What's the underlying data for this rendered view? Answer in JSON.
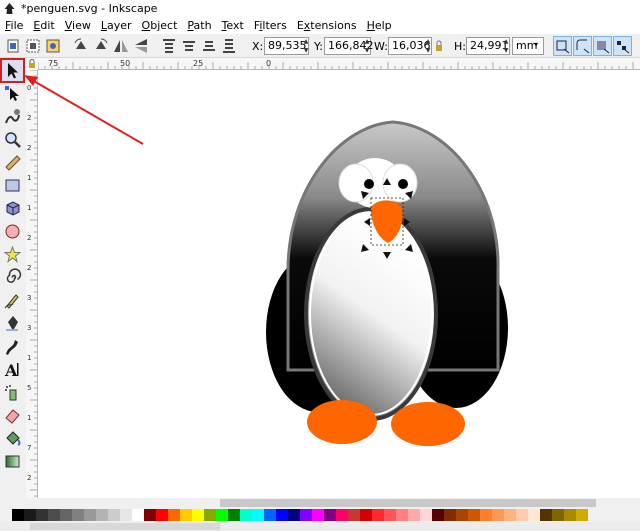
{
  "window": {
    "title": "*penguen.svg - Inkscape"
  },
  "menu": [
    "File",
    "Edit",
    "View",
    "Layer",
    "Object",
    "Path",
    "Text",
    "Filters",
    "Extensions",
    "Help"
  ],
  "menu_mnemonics": [
    "F",
    "E",
    "V",
    "L",
    "O",
    "P",
    "T",
    "i",
    "x",
    "H"
  ],
  "toolbar": {
    "x_label": "X:",
    "x_value": "89,535",
    "y_label": "Y:",
    "y_value": "166,842",
    "w_label": "W:",
    "w_value": "16,036",
    "h_label": "H:",
    "h_value": "24,991",
    "unit": "mm"
  },
  "hruler_labels": [
    "75",
    "50",
    "25",
    "0"
  ],
  "vruler_labels": [
    "0",
    "2",
    "2",
    "1",
    "1",
    "2",
    "2",
    "3",
    "3",
    "1",
    "5",
    "1",
    "7",
    "2"
  ],
  "tools": [
    "select-tool",
    "node-tool",
    "tweak-tool",
    "zoom-tool",
    "measure-tool",
    "rect-tool",
    "3dbox-tool",
    "ellipse-tool",
    "star-tool",
    "spiral-tool",
    "pencil-tool",
    "pen-tool",
    "calligraphy-tool",
    "text-tool",
    "spray-tool",
    "eraser-tool",
    "bucket-tool",
    "gradient-tool"
  ],
  "colors": {
    "accent_red": "#e02020",
    "penguin_orange": "#ff6600",
    "selection_blue": "#cde4f7"
  },
  "palette": [
    "#000000",
    "#1a1a1a",
    "#333333",
    "#4d4d4d",
    "#666666",
    "#808080",
    "#999999",
    "#b3b3b3",
    "#cccccc",
    "#e6e6e6",
    "#ffffff",
    "#800000",
    "#ff0000",
    "#ff6600",
    "#ffcc00",
    "#ffff00",
    "#88aa00",
    "#00ff00",
    "#008000",
    "#00ffcc",
    "#00ffff",
    "#0066ff",
    "#0000ff",
    "#000080",
    "#7f00ff",
    "#ff00ff",
    "#800080",
    "#ff0066",
    "#c83737",
    "#d40000",
    "#ff2a2a",
    "#ff5555",
    "#ff8080",
    "#ffaaaa",
    "#ffd5d5",
    "#550000",
    "#802b00",
    "#aa4400",
    "#d45500",
    "#ff7f2a",
    "#ff9955",
    "#ffb380",
    "#ffccaa",
    "#ffe6d5",
    "#553300",
    "#806600",
    "#aa8800",
    "#d4aa00"
  ]
}
